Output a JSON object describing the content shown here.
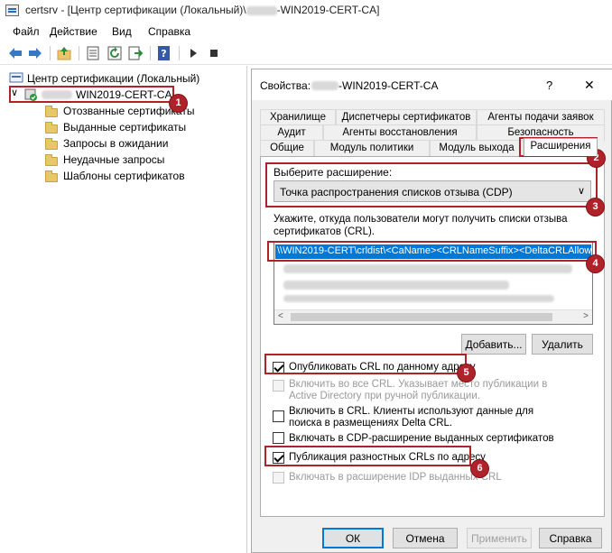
{
  "window": {
    "title_prefix": "certsrv - [Центр сертификации (Локальный)\\",
    "title_suffix": "-WIN2019-CERT-CA]"
  },
  "menu": [
    "Файл",
    "Действие",
    "Вид",
    "Справка"
  ],
  "toolbar_icons": [
    "back-icon",
    "forward-icon",
    "up-folder-icon",
    "properties-icon",
    "refresh-icon",
    "export-icon",
    "help-icon",
    "play-icon",
    "stop-icon"
  ],
  "tree": {
    "root": "Центр сертификации (Локальный)",
    "ca": "WIN2019-CERT-CA",
    "items": [
      "Отозванные сертификаты",
      "Выданные сертификаты",
      "Запросы в ожидании",
      "Неудачные запросы",
      "Шаблоны сертификатов"
    ]
  },
  "dialog": {
    "title_prefix": "Свойства:",
    "title_suffix": "-WIN2019-CERT-CA",
    "help": "?",
    "close": "✕",
    "tabs_row1": [
      "Хранилище",
      "Диспетчеры сертификатов",
      "Агенты подачи заявок"
    ],
    "tabs_row2": [
      "Аудит",
      "Агенты восстановления",
      "Безопасность"
    ],
    "tabs_row3": [
      "Общие",
      "Модуль политики",
      "Модуль выхода",
      "Расширения"
    ],
    "select_label": "Выберите расширение:",
    "select_value": "Точка распространения списков отзыва (CDP)",
    "desc": "Укажите, откуда пользователи могут получить списки отзыва сертификатов (CRL).",
    "list_first": "\\\\WIN2019-CERT\\crldist\\<CaName><CRLNameSuffix><DeltaCRLAllowe",
    "add_btn": "Добавить...",
    "remove_btn": "Удалить",
    "checks": [
      {
        "text": "Опубликовать CRL по данному адресу",
        "checked": true,
        "disabled": false
      },
      {
        "text": "Включить во все CRL. Указывает место публикации в Active Directory при ручной публикации.",
        "checked": false,
        "disabled": true
      },
      {
        "text": "Включить в CRL. Клиенты используют данные для поиска в размещениях Delta CRL.",
        "checked": false,
        "disabled": false
      },
      {
        "text": "Включать в CDP-расширение выданных сертификатов",
        "checked": false,
        "disabled": false
      },
      {
        "text": "Публикация разностных CRLs по адресу",
        "checked": true,
        "disabled": false
      },
      {
        "text": "Включать в расширение IDP выданных CRL",
        "checked": false,
        "disabled": true
      }
    ],
    "ok": "ОК",
    "cancel": "Отмена",
    "apply": "Применить",
    "help_btn": "Справка"
  },
  "badges": [
    "1",
    "2",
    "3",
    "4",
    "5",
    "6"
  ],
  "colors": {
    "annotation": "#b0222a",
    "selection": "#0078d7",
    "folder": "#e8c66a"
  }
}
